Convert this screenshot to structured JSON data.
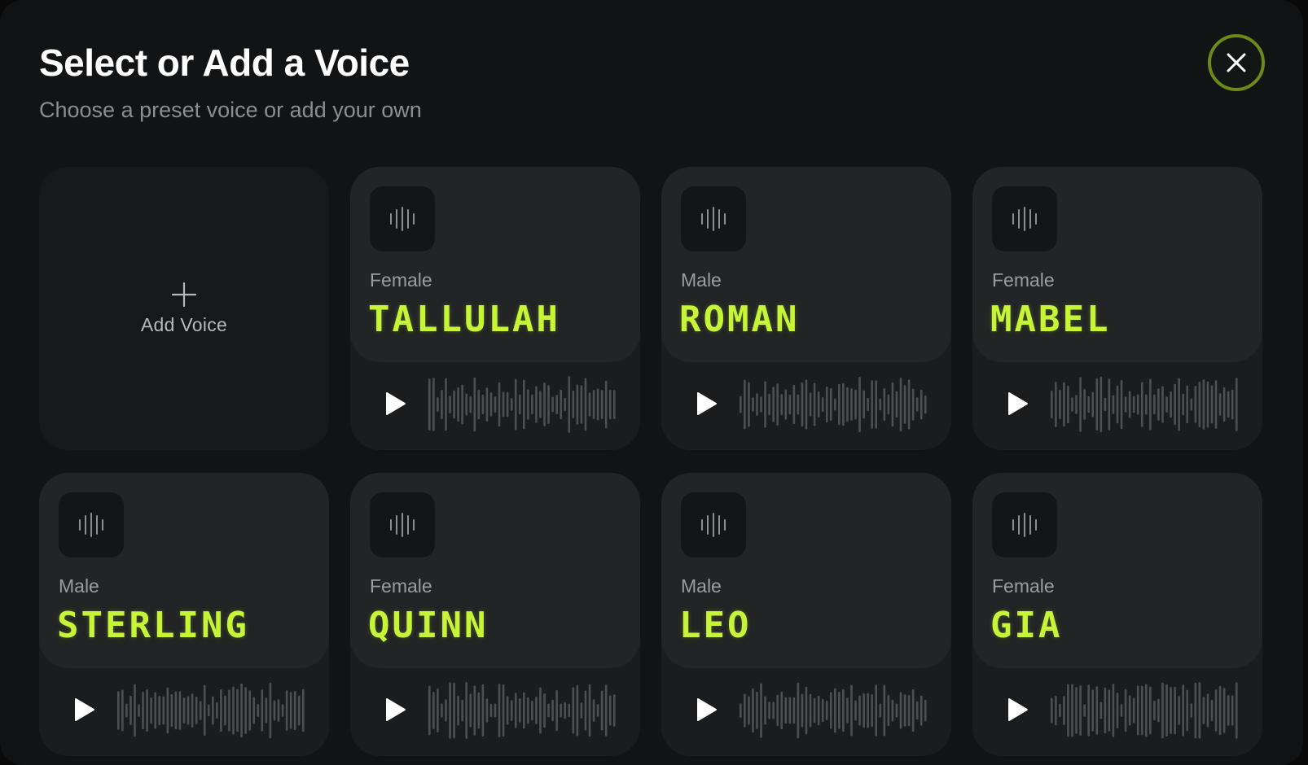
{
  "dialog": {
    "title": "Select or Add a Voice",
    "subtitle": "Choose a preset voice or add your own"
  },
  "add_voice": {
    "label": "Add Voice"
  },
  "voices": [
    {
      "gender": "Female",
      "name": "TALLULAH"
    },
    {
      "gender": "Male",
      "name": "ROMAN"
    },
    {
      "gender": "Female",
      "name": "MABEL"
    },
    {
      "gender": "Male",
      "name": "STERLING"
    },
    {
      "gender": "Female",
      "name": "QUINN"
    },
    {
      "gender": "Male",
      "name": "LEO"
    },
    {
      "gender": "Female",
      "name": "GIA"
    }
  ],
  "icons": {
    "close": "close-icon",
    "add": "plus-icon",
    "badge": "audio-wave-icon",
    "play": "play-icon"
  },
  "colors": {
    "accent": "#c5f536",
    "close_ring": "#6b8a1a",
    "background": "#121314",
    "card": "#1b1c1d"
  }
}
